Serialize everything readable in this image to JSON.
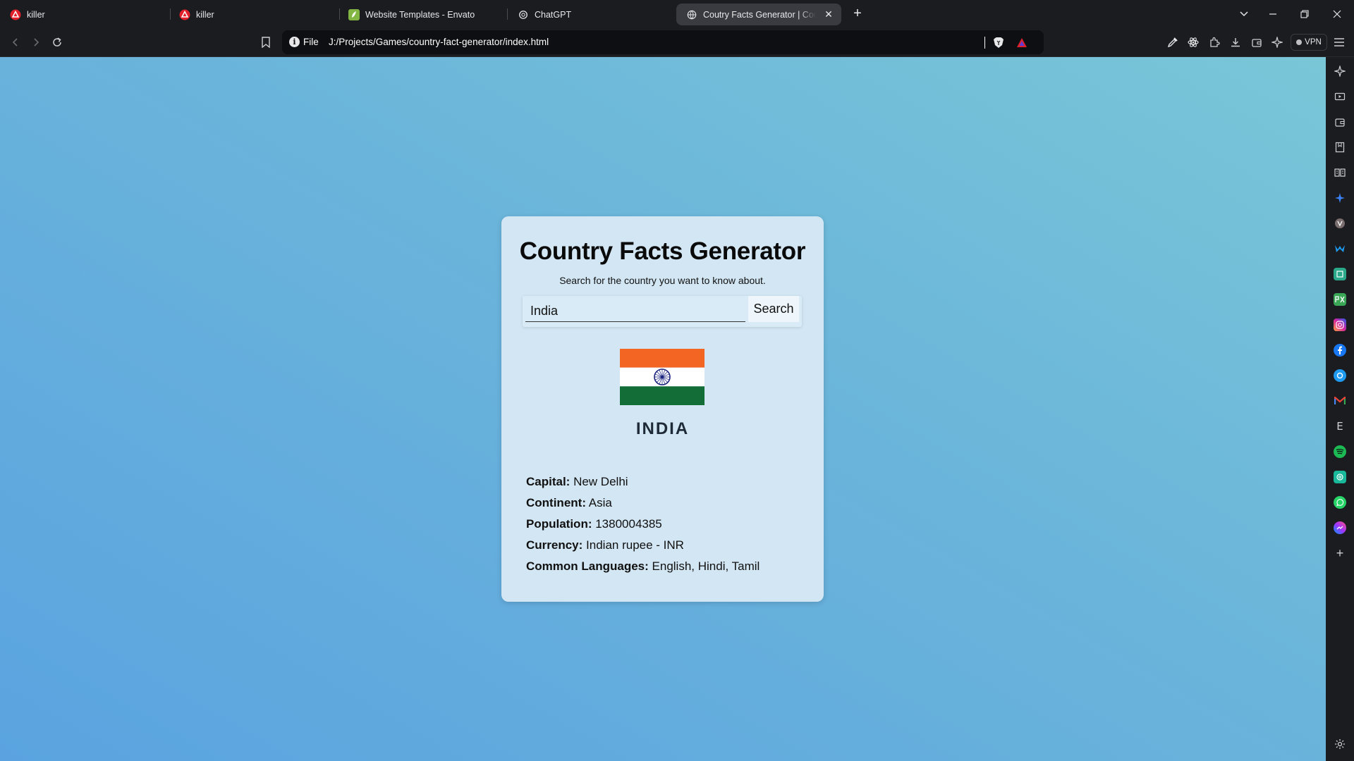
{
  "browser": {
    "tabs": [
      {
        "title": "killer",
        "favicon": "red-circle-logo-icon"
      },
      {
        "title": "killer",
        "favicon": "red-circle-logo-icon"
      },
      {
        "title": "Website Templates - Envato",
        "favicon": "envato-leaf-icon"
      },
      {
        "title": "ChatGPT",
        "favicon": "chatgpt-icon"
      },
      {
        "title": "Coutry Facts Generator | CodingNepal",
        "favicon": "globe-icon"
      }
    ],
    "address": {
      "scheme": "File",
      "url": "J:/Projects/Games/country-fact-generator/index.html"
    },
    "vpn_label": "VPN"
  },
  "page": {
    "title": "Country Facts Generator",
    "subtitle": "Search for the country you want to know about.",
    "search": {
      "value": "India",
      "button_label": "Search"
    },
    "country": {
      "name": "INDIA",
      "flag_colors": [
        "#f26522",
        "#ffffff",
        "#126d37"
      ],
      "chakra_color": "#1a237e"
    },
    "facts": [
      {
        "label": "Capital:",
        "value": "New Delhi"
      },
      {
        "label": "Continent:",
        "value": "Asia"
      },
      {
        "label": "Population:",
        "value": "1380004385"
      },
      {
        "label": "Currency:",
        "value": "Indian rupee - INR"
      },
      {
        "label": "Common Languages:",
        "value": "English, Hindi, Tamil"
      }
    ]
  },
  "sidebar_icons": [
    "leo-ai-icon",
    "media-icon",
    "wallet-icon",
    "bookmarks-icon",
    "reading-list-icon",
    "sparkle-icon",
    "brave-icon",
    "malwarebytes-icon",
    "notes-icon",
    "pixel-icon",
    "instagram-icon",
    "facebook-icon",
    "chatgpt-icon",
    "gmail-icon",
    "e-icon",
    "spotify-icon",
    "threads-icon",
    "whatsapp-icon",
    "messenger-icon",
    "add-icon"
  ],
  "colors": {
    "accent": "#3a3b41",
    "page_gradient_start": "#5aa3e0",
    "page_gradient_end": "#79c6d7",
    "card_bg": "#d2e6f3"
  }
}
